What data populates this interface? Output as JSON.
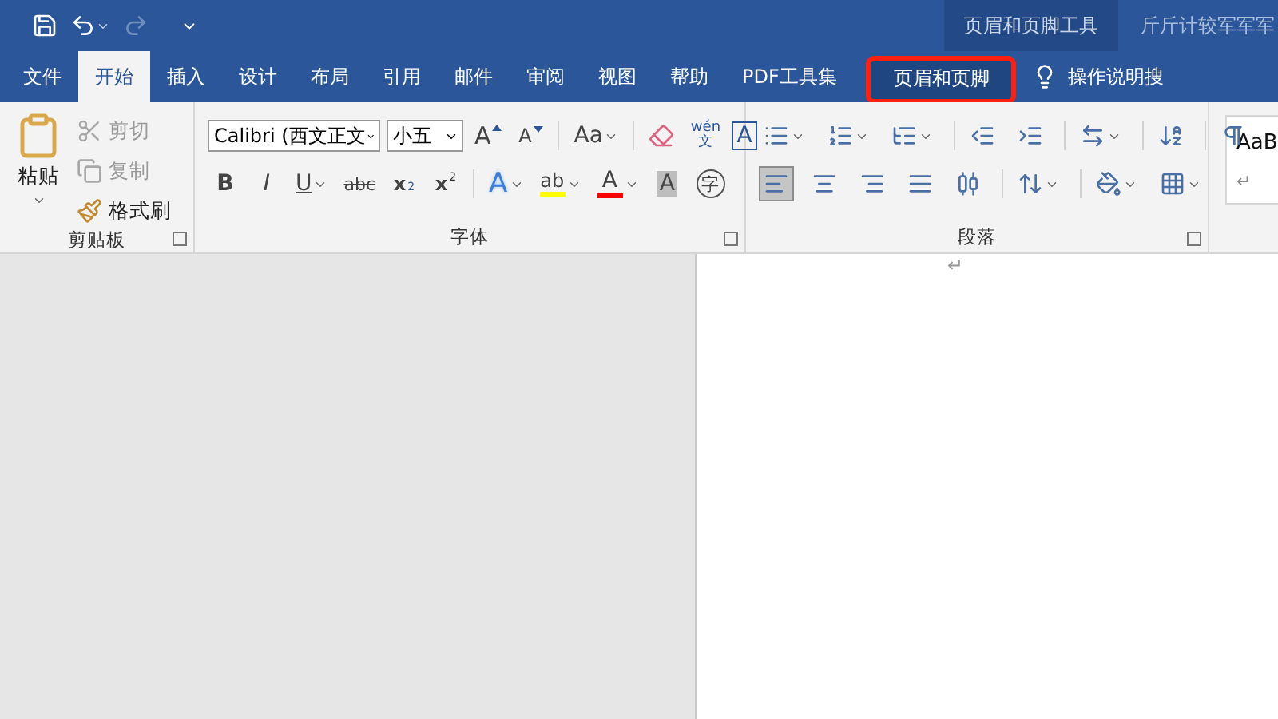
{
  "quick_access": {
    "redo_disabled": true
  },
  "contextual_group": "页眉和页脚工具",
  "document_title": "斤斤计较军军军",
  "tabs": [
    {
      "label": "文件",
      "selected": false,
      "contextual": false,
      "highlighted": false
    },
    {
      "label": "开始",
      "selected": true,
      "contextual": false,
      "highlighted": false
    },
    {
      "label": "插入",
      "selected": false,
      "contextual": false,
      "highlighted": false
    },
    {
      "label": "设计",
      "selected": false,
      "contextual": false,
      "highlighted": false
    },
    {
      "label": "布局",
      "selected": false,
      "contextual": false,
      "highlighted": false
    },
    {
      "label": "引用",
      "selected": false,
      "contextual": false,
      "highlighted": false
    },
    {
      "label": "邮件",
      "selected": false,
      "contextual": false,
      "highlighted": false
    },
    {
      "label": "审阅",
      "selected": false,
      "contextual": false,
      "highlighted": false
    },
    {
      "label": "视图",
      "selected": false,
      "contextual": false,
      "highlighted": false
    },
    {
      "label": "帮助",
      "selected": false,
      "contextual": false,
      "highlighted": false
    },
    {
      "label": "PDF工具集",
      "selected": false,
      "contextual": false,
      "highlighted": false
    },
    {
      "label": "页眉和页脚",
      "selected": false,
      "contextual": true,
      "highlighted": true
    }
  ],
  "search": {
    "placeholder": "操作说明搜"
  },
  "clipboard": {
    "paste": "粘贴",
    "items": [
      {
        "kind": "cut",
        "label": "剪切",
        "disabled": true
      },
      {
        "kind": "copy",
        "label": "复制",
        "disabled": true
      },
      {
        "kind": "painter",
        "label": "格式刷",
        "disabled": false
      }
    ],
    "group_label": "剪贴板"
  },
  "font": {
    "name": "Calibri (西文正文",
    "size": "小五",
    "group_label": "字体",
    "row1": [
      {
        "kind": "grow",
        "glyph": "A",
        "caret": false
      },
      {
        "kind": "shrink",
        "glyph": "A",
        "caret": false
      },
      {
        "kind": "case",
        "glyph": "Aa",
        "caret": true
      },
      {
        "kind": "clear",
        "caret": false
      },
      {
        "kind": "phonetic",
        "glyph": "wén",
        "sub": "文",
        "caret": false
      },
      {
        "kind": "border",
        "glyph": "A",
        "caret": false
      }
    ],
    "row2": [
      {
        "kind": "bold",
        "glyph": "B",
        "caret": false
      },
      {
        "kind": "italic",
        "glyph": "I",
        "caret": false
      },
      {
        "kind": "underline",
        "glyph": "U",
        "caret": true
      },
      {
        "kind": "strike",
        "glyph": "abc",
        "caret": false
      },
      {
        "kind": "subscript",
        "glyph": "x",
        "sub": "2",
        "caret": false
      },
      {
        "kind": "superscript",
        "glyph": "x",
        "sup": "2",
        "caret": false
      },
      {
        "kind": "effects",
        "glyph": "A",
        "caret": true
      },
      {
        "kind": "highlight",
        "glyph": "ab",
        "color": "#ffff00",
        "caret": true
      },
      {
        "kind": "color",
        "glyph": "A",
        "color": "#ff0000",
        "caret": true
      },
      {
        "kind": "shading",
        "glyph": "A",
        "caret": false
      },
      {
        "kind": "enclose",
        "glyph": "字",
        "caret": false
      }
    ]
  },
  "paragraph": {
    "group_label": "段落",
    "row1": [
      {
        "kind": "bullets",
        "caret": true
      },
      {
        "kind": "numbering",
        "caret": true
      },
      {
        "kind": "multilevel",
        "caret": true
      },
      {
        "kind": "outdent",
        "caret": false
      },
      {
        "kind": "indent",
        "caret": false
      },
      {
        "kind": "asian",
        "caret": true
      },
      {
        "kind": "sort",
        "caret": false
      },
      {
        "kind": "marks",
        "caret": false
      }
    ],
    "row2": [
      {
        "kind": "left",
        "selected": true,
        "caret": false
      },
      {
        "kind": "center",
        "selected": false,
        "caret": false
      },
      {
        "kind": "right",
        "selected": false,
        "caret": false
      },
      {
        "kind": "justify",
        "selected": false,
        "caret": false
      },
      {
        "kind": "distributed",
        "selected": false,
        "caret": false
      },
      {
        "kind": "spacing",
        "selected": false,
        "caret": true
      },
      {
        "kind": "fill",
        "selected": false,
        "caret": true
      },
      {
        "kind": "borders",
        "selected": false,
        "caret": true
      }
    ]
  },
  "styles": {
    "sample": "AaB",
    "mark": "↵"
  },
  "page": {
    "paragraph_mark": "↵"
  }
}
